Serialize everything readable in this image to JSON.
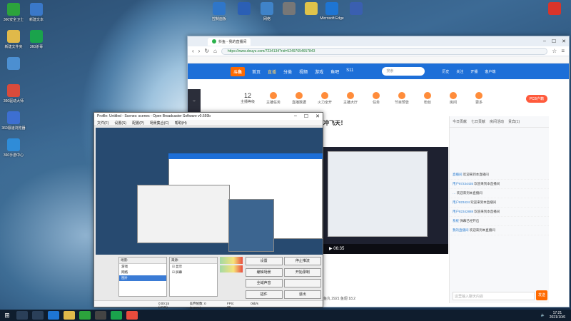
{
  "desktop": {
    "icons_left": [
      {
        "label": "360安全卫士",
        "color": "#2ca33c"
      },
      {
        "label": "新建文本",
        "color": "#3a78c9"
      },
      {
        "label": "新建文件夹",
        "color": "#e0b94a"
      },
      {
        "label": "360杀毒",
        "color": "#1aa34c"
      },
      {
        "label": "",
        "color": "#4c8fd1"
      },
      {
        "label": "360软件管家",
        "color": "#f28c1f"
      },
      {
        "label": "360驱动大师",
        "color": "#d84b3c"
      },
      {
        "label": "360安全浏览器",
        "color": "#25a53a"
      },
      {
        "label": "360极速浏览器",
        "color": "#3d6fd1"
      },
      {
        "label": "360画报",
        "color": "#d33a5a"
      },
      {
        "label": "360手游中心",
        "color": "#2f8cd8"
      },
      {
        "label": "工具箱",
        "color": "#e4a12a"
      }
    ],
    "icons_top": [
      {
        "label": "控制面板",
        "color": "#2f76c9"
      },
      {
        "label": "",
        "color": "#2b5fb5"
      },
      {
        "label": "网络",
        "color": "#3f83c9"
      },
      {
        "label": "",
        "color": "#777777"
      },
      {
        "label": "",
        "color": "#e0c34a"
      },
      {
        "label": "Microsoft Edge",
        "color": "#1e75d3"
      },
      {
        "label": "",
        "color": "#3a5fb0"
      },
      {
        "label": "",
        "color": "#d8342a"
      }
    ]
  },
  "browser": {
    "tab_title": "抖鱼 - 我的直播间",
    "url": "https://www.douyu.com/7234134?rid=52497654657843",
    "nav": {
      "logo": "斗鱼",
      "items": [
        "首页",
        "直播",
        "分类",
        "视频",
        "游戏",
        "鱼吧",
        "S11"
      ],
      "active_index": 1,
      "search_placeholder": "搜索",
      "user_items": [
        "历史",
        "关注",
        "开播",
        "客户端"
      ]
    },
    "stats": [
      {
        "num": "12",
        "label": "主播等级"
      },
      {
        "num": "",
        "label": "主播任务"
      },
      {
        "num": "",
        "label": "直播数据"
      },
      {
        "num": "",
        "label": "火力全开"
      },
      {
        "num": "",
        "label": "主播大厅"
      },
      {
        "num": "",
        "label": "任务"
      },
      {
        "num": "",
        "label": "节目预告"
      },
      {
        "num": "",
        "label": "粉丝"
      },
      {
        "num": "",
        "label": "房间"
      },
      {
        "num": "",
        "label": "更多"
      }
    ],
    "room_title": "冲飞天！",
    "pcb_label": "PCB户籍",
    "player_time": "06:35",
    "chat": {
      "tabs": [
        "今日贡献",
        "七日贡献",
        "房间活动",
        "贵宾(1)"
      ],
      "messages": [
        {
          "user": "直播间",
          "text": "欢迎来到本直播间"
        },
        {
          "user": "用户87234435",
          "text": "欢迎来到本直播间"
        },
        {
          "user": "…",
          "text": "欢迎来到本直播间"
        },
        {
          "user": "用户823424",
          "text": "欢迎来到本直播间"
        },
        {
          "user": "用户82342888",
          "text": "欢迎来到本直播间"
        },
        {
          "user": "系统",
          "text": "弹幕已经开启"
        },
        {
          "user": "我的直播间",
          "text": "欢迎来到本直播间"
        }
      ],
      "input_placeholder": "这里输入聊天内容",
      "send_label": "发送",
      "footer": "鱼丸 2921  鱼翅 18.2"
    }
  },
  "obs": {
    "title": "Profile: Untitled - Scenes: scenes - Open Broadcaster Software v0.659b",
    "menu": [
      "文件(F)",
      "设置(S)",
      "配置(P)",
      "场景集合(C)",
      "帮助(H)"
    ],
    "scenes_header": "场景:",
    "sources_header": "来源:",
    "scenes": [
      "游戏",
      "网络",
      "图片"
    ],
    "selected_scene": 2,
    "sources": [
      "显示",
      "屏幕"
    ],
    "buttons": [
      "设置",
      "停止推流",
      "编辑场景",
      "开始录制",
      "全域声音",
      "",
      "插件",
      "退出"
    ],
    "status": [
      "0:00:15 (LIVE)",
      "丢弃帧数: 0 (0.00%)",
      "FPS: 29",
      "0kb/s"
    ]
  },
  "taskbar": {
    "time": "17:21",
    "date": "2021/10/6"
  }
}
